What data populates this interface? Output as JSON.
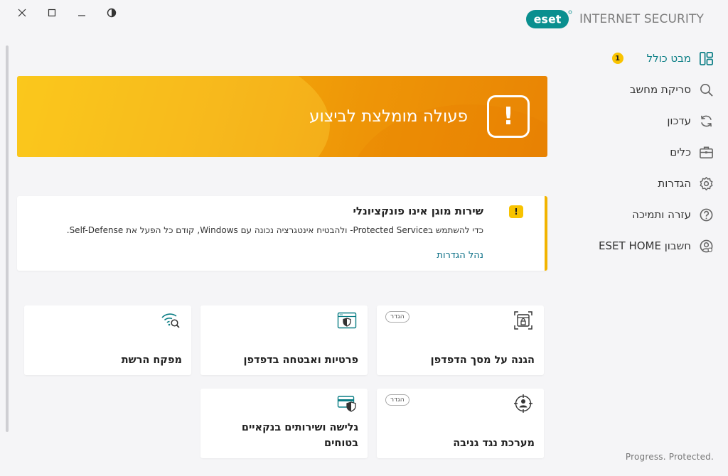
{
  "window": {
    "close": "close-icon",
    "maximize": "maximize-icon",
    "minimize": "minimize-icon",
    "theme": "contrast-icon"
  },
  "brand": {
    "logo_text": "eset",
    "product_name": "INTERNET SECURITY"
  },
  "sidebar": {
    "items": [
      {
        "label": "מבט כולל",
        "icon": "dashboard-icon",
        "active": true,
        "badge": "1"
      },
      {
        "label": "סריקת מחשב",
        "icon": "search-icon"
      },
      {
        "label": "עדכון",
        "icon": "refresh-icon"
      },
      {
        "label": "כלים",
        "icon": "briefcase-icon"
      },
      {
        "label": "הגדרות",
        "icon": "gear-icon"
      },
      {
        "label": "עזרה ותמיכה",
        "icon": "help-icon"
      },
      {
        "label": "חשבון ESET HOME",
        "icon": "account-icon"
      }
    ]
  },
  "banner": {
    "title": "פעולה מומלצת לביצוע",
    "icon_text": "!"
  },
  "warning": {
    "icon_text": "!",
    "title": "שירות מוגן אינו פונקציונלי",
    "description": "כדי להשתמש בProtected Service- ולהבטיח אינטגרציה נכונה עם Windows, קודם כל הפעל את Self-Defense.",
    "link": "נהל הגדרות"
  },
  "tiles": [
    {
      "title": "הגנה על מסך הדפדפן",
      "icon": "browser-lock-icon",
      "badge": "הגדר"
    },
    {
      "title": "פרטיות ואבטחה בדפדפן",
      "icon": "browser-shield-icon"
    },
    {
      "title": "מפקח הרשת",
      "icon": "wifi-search-icon"
    },
    {
      "title": "מערכת נגד גניבה",
      "icon": "anti-theft-icon",
      "badge": "הגדר"
    },
    {
      "title": "גלישה ושירותים בנקאיים בטוחים",
      "icon": "card-shield-icon"
    }
  ],
  "footer": {
    "tagline": "Progress. Protected."
  },
  "colors": {
    "accent": "#0b7e85",
    "warning": "#f8c300",
    "banner_start": "#f8c00c",
    "banner_end": "#e98404"
  }
}
